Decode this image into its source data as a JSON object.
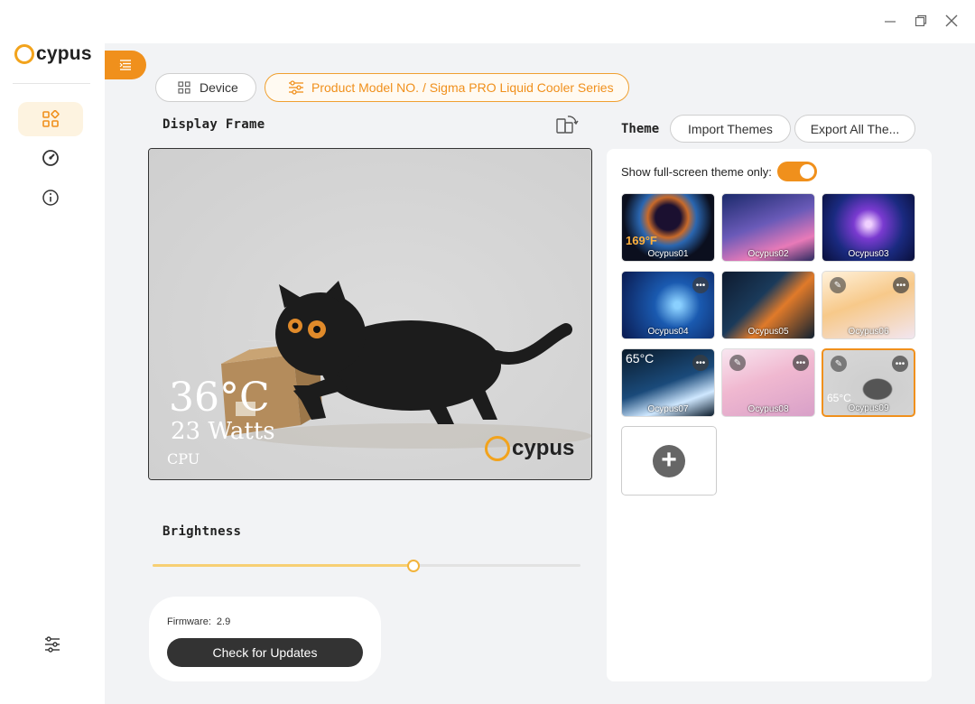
{
  "app": {
    "logo_text": "cypus"
  },
  "window": {
    "minimize": "—",
    "restore": "❐",
    "close": "✕"
  },
  "header": {
    "device_label": "Device",
    "model_label": "Product Model NO. / Sigma PRO Liquid Cooler Series"
  },
  "display": {
    "title": "Display Frame",
    "temperature": "36°C",
    "watts": "23 Watts",
    "sensor": "CPU",
    "logo_text": "cypus"
  },
  "brightness": {
    "title": "Brightness",
    "value_percent": 61
  },
  "firmware": {
    "label": "Firmware:",
    "version": "2.9",
    "update_button": "Check for Updates"
  },
  "theme": {
    "title": "Theme",
    "import_button": "Import Themes",
    "export_button": "Export All The...",
    "fullscreen_label": "Show full-screen theme only:",
    "fullscreen_on": true,
    "tiles": [
      {
        "name": "Ocypus01",
        "temp": "169°F"
      },
      {
        "name": "Ocypus02"
      },
      {
        "name": "Ocypus03"
      },
      {
        "name": "Ocypus04"
      },
      {
        "name": "Ocypus05"
      },
      {
        "name": "Ocypus06"
      },
      {
        "name": "Ocypus07",
        "temp": "65°C"
      },
      {
        "name": "Ocypus08"
      },
      {
        "name": "Ocypus09",
        "temp": "65°C"
      }
    ],
    "add_symbol": "+"
  },
  "colors": {
    "accent": "#f0901c",
    "logo_ring": "#f2a31c"
  }
}
